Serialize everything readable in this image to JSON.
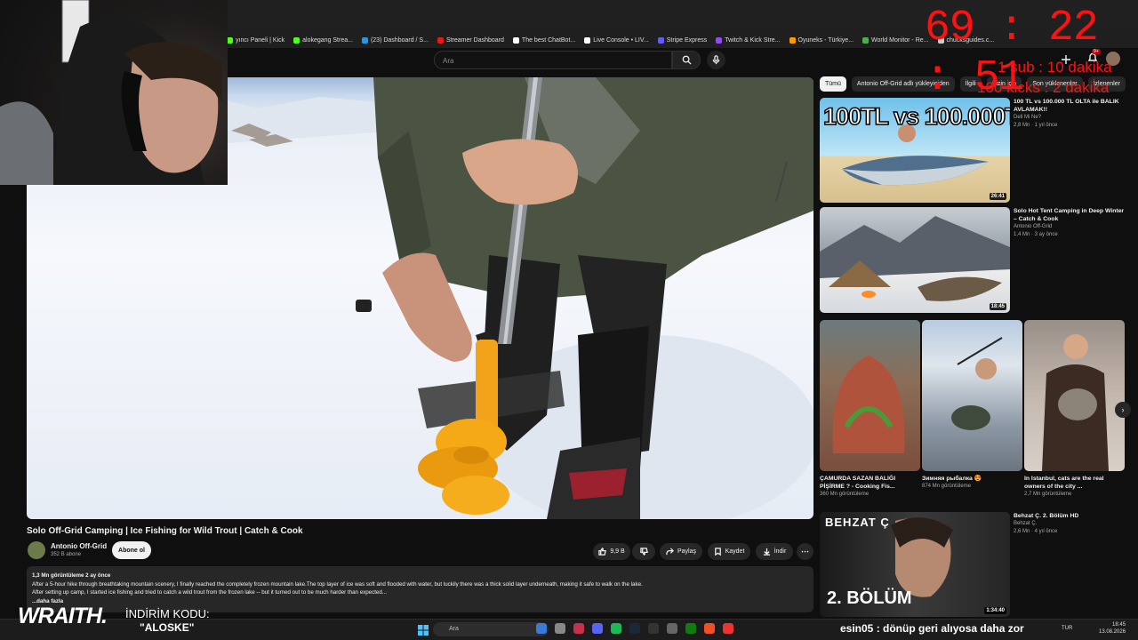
{
  "browser": {
    "bookmarks": [
      {
        "label": "yıncı Paneli | Kick",
        "color": "#53fc18"
      },
      {
        "label": "alokegang Strea...",
        "color": "#53fc18"
      },
      {
        "label": "(23) Dashboard / S...",
        "color": "#1d9bf0"
      },
      {
        "label": "Streamer Dashboard",
        "color": "#e91916"
      },
      {
        "label": "The best ChatBot...",
        "color": "#ffffff"
      },
      {
        "label": "Live Console • LIV...",
        "color": "#ffffff"
      },
      {
        "label": "Stripe Express",
        "color": "#635bff"
      },
      {
        "label": "Twitch & Kick Stre...",
        "color": "#9146ff"
      },
      {
        "label": "Oyuneks - Türkiye...",
        "color": "#ff9a00"
      },
      {
        "label": "World Monitor - Re...",
        "color": "#4caf50"
      },
      {
        "label": "chucksguides.c...",
        "color": "#cccccc"
      }
    ]
  },
  "search": {
    "placeholder": "Ara"
  },
  "video": {
    "title": "Solo Off-Grid Camping | Ice Fishing for Wild Trout | Catch & Cook",
    "channel": "Antonio Off-Grid",
    "subscribers": "352 B abone",
    "subscribe_label": "Abone ol",
    "likes": "9,9 B",
    "share_label": "Paylaş",
    "save_label": "Kaydet",
    "download_label": "İndir",
    "views_date": "1,3 Mn görüntüleme  2 ay önce",
    "description_line1": "After a 5-hour hike through breathtaking mountain scenery, I finally reached the completely frozen mountain lake.The top layer of ice was soft and flooded with water, but luckily there was a thick solid layer underneath, making it safe to walk on the lake.",
    "description_line2": "After setting up camp, I started ice fishing and tried to catch a wild trout from the frozen lake -- but it turned out to be much harder than expected...",
    "more_label": "...daha fazla"
  },
  "sidebar": {
    "chips": [
      "Tümü",
      "Antonio Off-Grid adlı yükleyiciden",
      "İlgili",
      "Sizin için",
      "Son yüklenenler",
      "İzlenenler"
    ],
    "videos": [
      {
        "title": "100 TL vs 100.000 TL OLTA ile BALIK AVLAMAK!!",
        "channel": "Deli Mi Ne?",
        "meta": "2,8 Mn  ·  1 yıl önce",
        "duration": "26:41",
        "thumb_text": "100TL vs 100.000TL"
      },
      {
        "title": "Solo Hot Tent Camping in Deep Winter – Catch & Cook",
        "channel": "Antonio Off-Grid",
        "meta": "1,4 Mn  ·  3 ay önce",
        "duration": "18:45"
      },
      {
        "title": "Behzat Ç. 2. Bölüm HD",
        "channel": "Behzat Ç.",
        "meta": "2,6 Mn  ·  4 yıl önce",
        "duration": "1:34:40",
        "thumb_top": "BEHZAT Ç",
        "thumb_bottom": "2. BÖLÜM"
      }
    ],
    "shorts": [
      {
        "title": "ÇAMURDA SAZAN BALIĞI PİŞİRME ? - Cooking Fis...",
        "meta": "360 Mn görüntüleme"
      },
      {
        "title": "Зимняя рыбалка 😍",
        "meta": "874 Mn görüntüleme"
      },
      {
        "title": "In Istanbul, cats are the real owners of the city ...",
        "meta": "2,7 Mn görüntüleme"
      }
    ]
  },
  "overlay": {
    "timer": "69 : 22 : 51",
    "line1": "1 sub : 10 dakika",
    "line2": "100 kicks : 2 dakika",
    "sponsor": "WRAITH.",
    "promo_label": "İNDİRİM KODU:",
    "promo_code": "\"ALOSKE\"",
    "chat_user": "esin05",
    "chat_message": " : dönüp geri alıyosa daha zor"
  },
  "taskbar": {
    "search_placeholder": "Ara",
    "language": "TUR",
    "time": "18:45",
    "date": "13.08.2026"
  },
  "colors": {
    "accent_red": "#ff1111",
    "background": "#0f0f0f",
    "surface": "#272727"
  }
}
